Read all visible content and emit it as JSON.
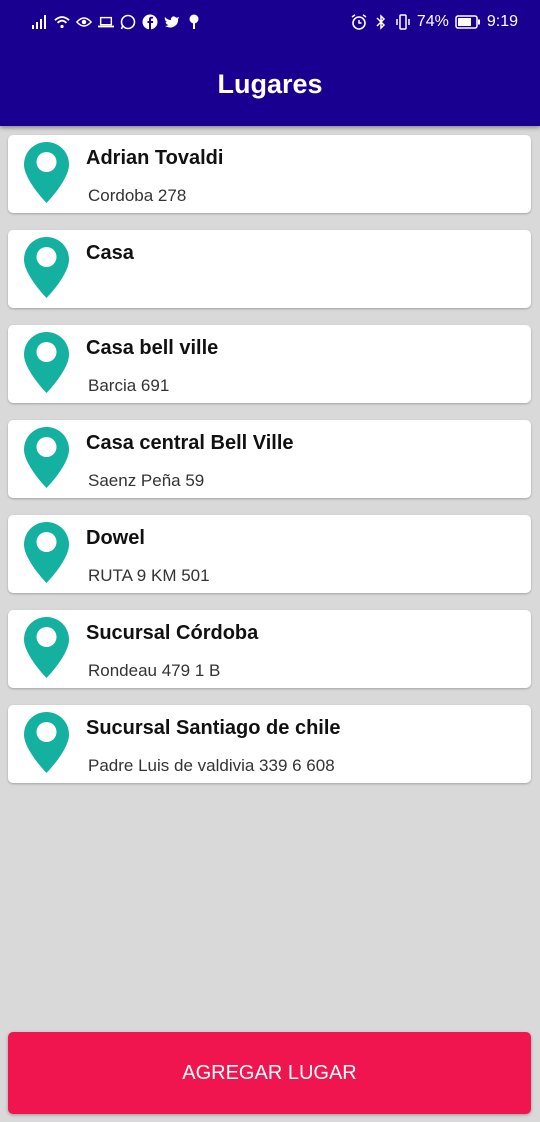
{
  "status_bar": {
    "battery": "74%",
    "time": "9:19",
    "left_icons": [
      "signal-icon",
      "wifi-icon",
      "eye-icon",
      "laptop-icon",
      "whatsapp-icon",
      "facebook-icon",
      "twitter-icon",
      "location-icon"
    ],
    "right_icons": [
      "alarm-icon",
      "bluetooth-icon",
      "vibrate-icon",
      "battery-icon"
    ]
  },
  "app_bar": {
    "title": "Lugares"
  },
  "places": [
    {
      "name": "Adrian Tovaldi",
      "address": "Cordoba 278"
    },
    {
      "name": "Casa",
      "address": ""
    },
    {
      "name": "Casa bell ville",
      "address": "Barcia 691"
    },
    {
      "name": "Casa central Bell Ville",
      "address": "Saenz Peña 59"
    },
    {
      "name": "Dowel",
      "address": "RUTA 9 KM 501"
    },
    {
      "name": "Sucursal Córdoba",
      "address": "Rondeau 479 1 B"
    },
    {
      "name": "Sucursal Santiago de chile",
      "address": "Padre Luis de valdivia 339 6 608"
    }
  ],
  "add_button": {
    "label": "AGREGAR LUGAR"
  },
  "colors": {
    "primary": "#1a0090",
    "accent": "#f0154f",
    "pin": "#14b0a0",
    "background": "#d9d9d9"
  }
}
